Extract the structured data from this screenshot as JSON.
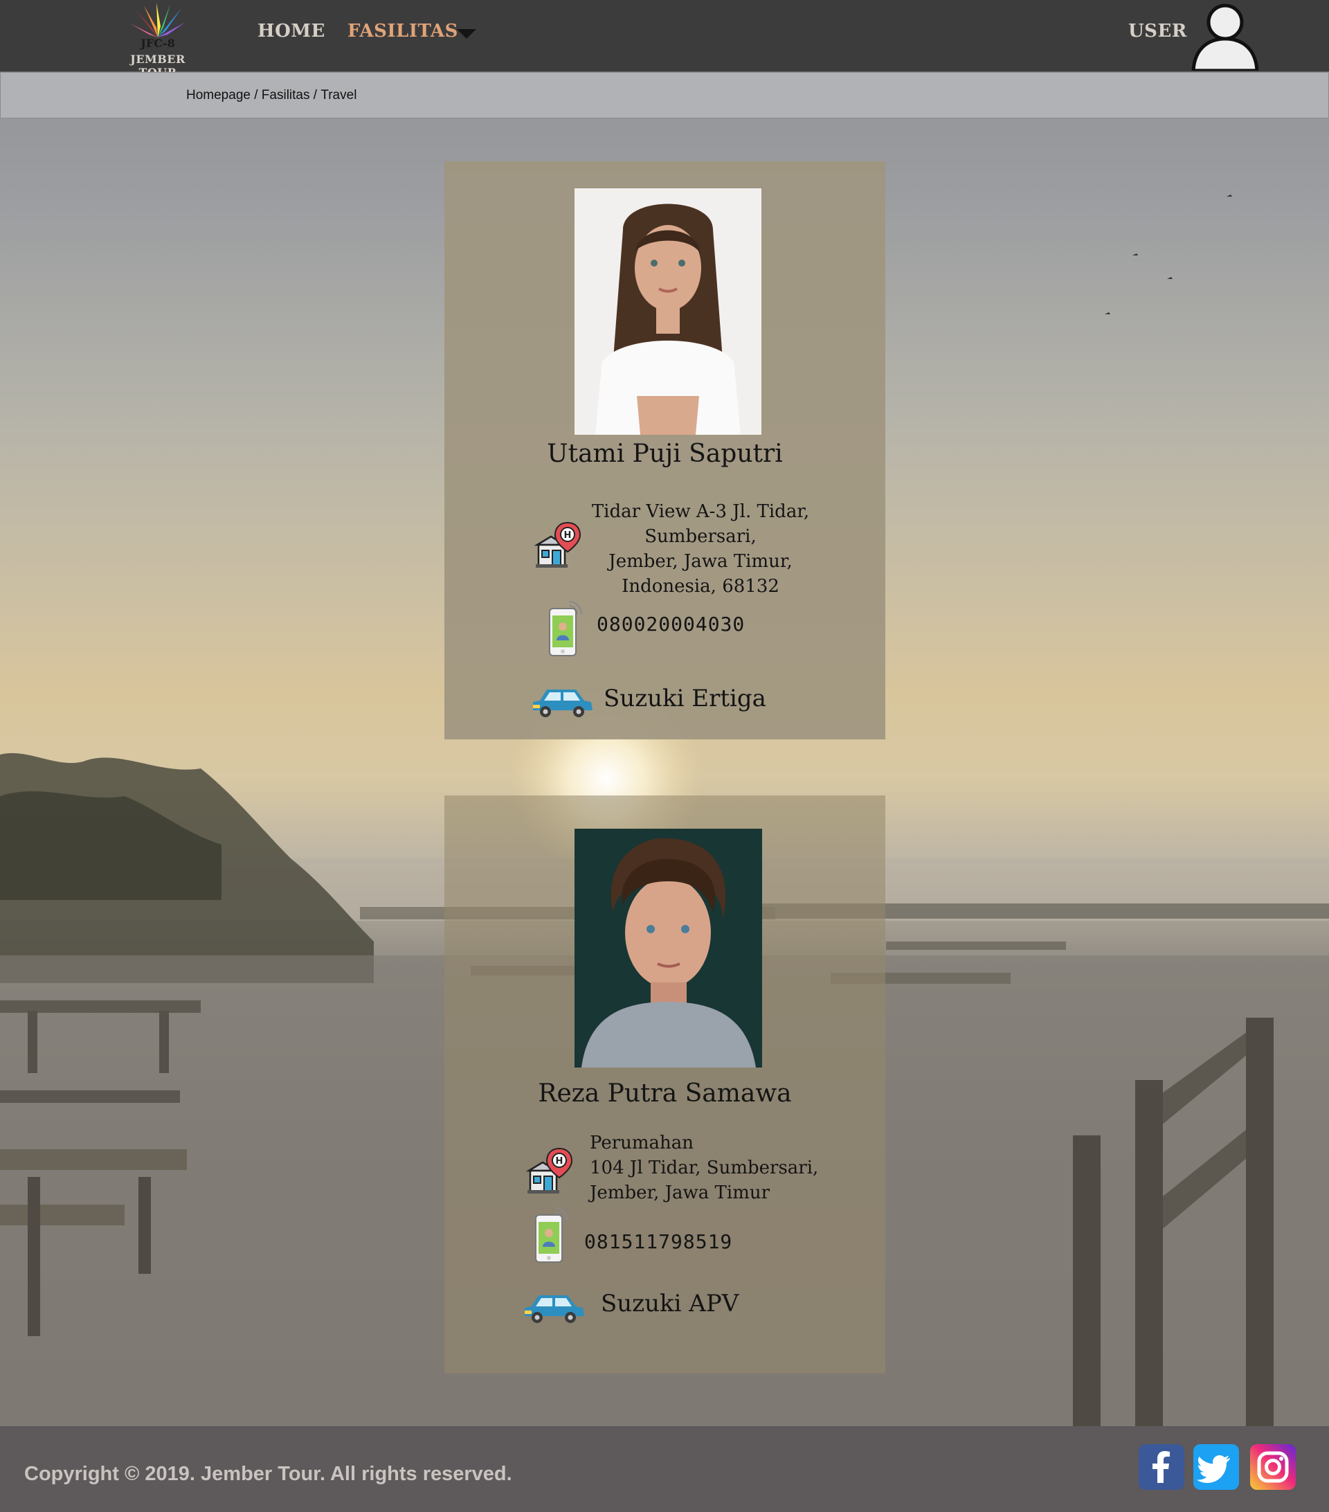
{
  "brand": {
    "logo_text": "JFC-8",
    "caption": "JEMBER TOUR"
  },
  "nav": {
    "home": "HOME",
    "fasilitas": "FASILITAS",
    "user": "USER"
  },
  "breadcrumb": {
    "items": [
      "Homepage",
      "Fasilitas",
      "Travel"
    ],
    "separator": " / "
  },
  "drivers": [
    {
      "name": "Utami Puji Saputri",
      "address": "Tidar View A-3 Jl. Tidar,\nSumbersari,\nJember, Jawa Timur,\nIndonesia, 68132",
      "phone": "080020004030",
      "car": "Suzuki Ertiga"
    },
    {
      "name": "Reza Putra Samawa",
      "address": "Perumahan\n104 Jl Tidar, Sumbersari,\nJember, Jawa Timur",
      "phone": "081511798519",
      "car": "Suzuki APV"
    }
  ],
  "footer": {
    "copyright": "Copyright © 2019. Jember Tour. All rights reserved."
  },
  "social": {
    "facebook_icon": "facebook-icon",
    "twitter_icon": "twitter-icon",
    "instagram_icon": "instagram-icon"
  },
  "colors": {
    "navbar": "#3d3c3d",
    "nav_active": "#e0a478",
    "breadcrumb_bar": "#b0b2b5",
    "card": "#a0967f",
    "footer": "#5e595a"
  }
}
